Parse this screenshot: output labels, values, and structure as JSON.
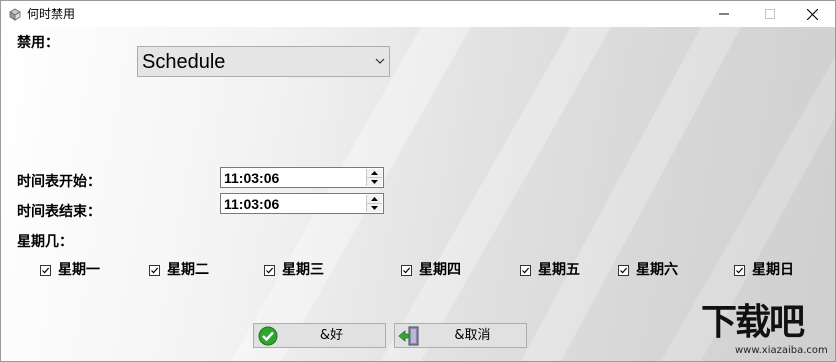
{
  "window": {
    "title": "何时禁用",
    "controls": {
      "minimize": "—",
      "maximize": "☐",
      "close": "✕"
    }
  },
  "disable": {
    "label": "禁用：",
    "selected": "Schedule"
  },
  "schedule": {
    "start_label": "时间表开始：",
    "start_value": "11:03:06",
    "end_label": "时间表结束：",
    "end_value": "11:03:06"
  },
  "weekdays": {
    "label": "星期几：",
    "days": [
      {
        "label": "星期一",
        "checked": true
      },
      {
        "label": "星期二",
        "checked": true
      },
      {
        "label": "星期三",
        "checked": true
      },
      {
        "label": "星期四",
        "checked": true
      },
      {
        "label": "星期五",
        "checked": true
      },
      {
        "label": "星期六",
        "checked": true
      },
      {
        "label": "星期日",
        "checked": true
      }
    ]
  },
  "buttons": {
    "ok": {
      "label": "&好",
      "icon": "check-icon"
    },
    "cancel": {
      "label": "&取消",
      "icon": "exit-door-icon"
    }
  },
  "watermark": {
    "brand": "下载吧",
    "url": "www.xiazaiba.com"
  }
}
